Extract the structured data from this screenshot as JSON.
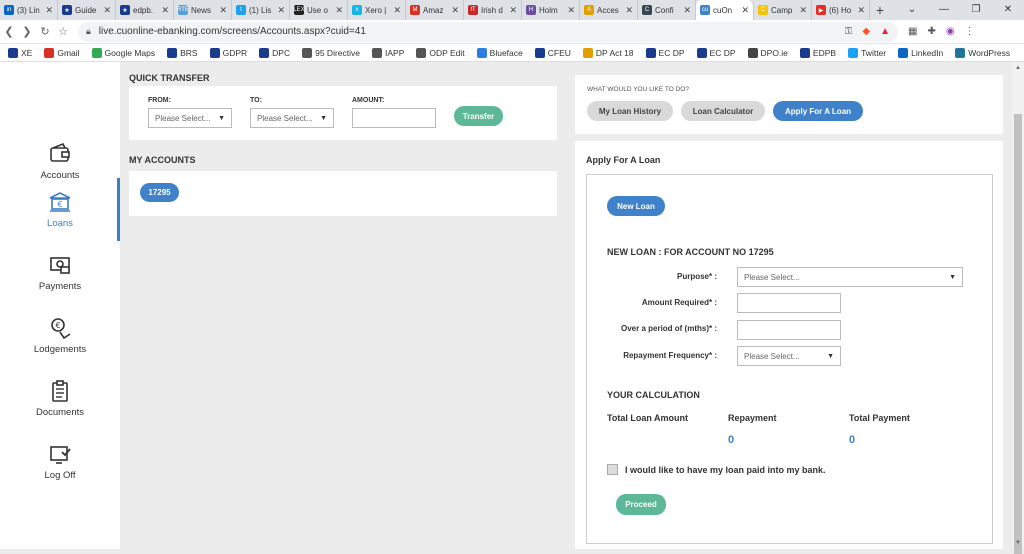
{
  "browser": {
    "tabs": [
      {
        "title": "(3) Lin",
        "favicon": "#0a66c2",
        "glyph": "in"
      },
      {
        "title": "Guide",
        "favicon": "#1a3c8f",
        "glyph": "★"
      },
      {
        "title": "edpb.",
        "favicon": "#1a3c8f",
        "glyph": "★"
      },
      {
        "title": "News",
        "favicon": "#5aa0d8",
        "glyph": "RTÉ"
      },
      {
        "title": "(1) Lis",
        "favicon": "#1da1f2",
        "glyph": "t"
      },
      {
        "title": "Use o",
        "favicon": "#222222",
        "glyph": "LEX"
      },
      {
        "title": "Xero |",
        "favicon": "#13b5ea",
        "glyph": "x"
      },
      {
        "title": "Amaz",
        "favicon": "#d93025",
        "glyph": "M"
      },
      {
        "title": "Irish d",
        "favicon": "#c62828",
        "glyph": "IT"
      },
      {
        "title": "Holm",
        "favicon": "#6a4fa3",
        "glyph": "H"
      },
      {
        "title": "Acces",
        "favicon": "#e0a100",
        "glyph": "A"
      },
      {
        "title": "Confi",
        "favicon": "#37474f",
        "glyph": "C"
      },
      {
        "title": "cuOn",
        "favicon": "#3f82c9",
        "glyph": "cu",
        "active": true
      },
      {
        "title": "Camp",
        "favicon": "#f5c400",
        "glyph": "C"
      },
      {
        "title": "(6) Ho",
        "favicon": "#e52d27",
        "glyph": "▶"
      }
    ],
    "url": "live.cuonline-ebanking.com/screens/Accounts.aspx?cuid=41",
    "bookmarks": [
      {
        "label": "XE",
        "color": "#1a3c8f"
      },
      {
        "label": "Gmail",
        "color": "#d93025"
      },
      {
        "label": "Google Maps",
        "color": "#34a853"
      },
      {
        "label": "BRS",
        "color": "#1a3c8f"
      },
      {
        "label": "GDPR",
        "color": "#1a3c8f"
      },
      {
        "label": "DPC",
        "color": "#1a3c8f"
      },
      {
        "label": "95 Directive",
        "color": "#555555"
      },
      {
        "label": "IAPP",
        "color": "#555555"
      },
      {
        "label": "ODP Edit",
        "color": "#555555"
      },
      {
        "label": "Blueface",
        "color": "#2a7de1"
      },
      {
        "label": "CFEU",
        "color": "#1a3c8f"
      },
      {
        "label": "DP Act 18",
        "color": "#e0a100"
      },
      {
        "label": "EC DP",
        "color": "#1a3c8f"
      },
      {
        "label": "EC DP",
        "color": "#1a3c8f"
      },
      {
        "label": "DPO.ie",
        "color": "#444444"
      },
      {
        "label": "EDPB",
        "color": "#1a3c8f"
      },
      {
        "label": "Twitter",
        "color": "#1da1f2"
      },
      {
        "label": "LinkedIn",
        "color": "#0a66c2"
      },
      {
        "label": "WordPress",
        "color": "#21759b"
      }
    ]
  },
  "sidebar": {
    "items": [
      {
        "label": "Accounts",
        "icon": "wallet-icon"
      },
      {
        "label": "Loans",
        "icon": "bank-icon",
        "active": true
      },
      {
        "label": "Payments",
        "icon": "payments-icon"
      },
      {
        "label": "Lodgements",
        "icon": "lodgement-icon"
      },
      {
        "label": "Documents",
        "icon": "documents-icon"
      },
      {
        "label": "Log Off",
        "icon": "logoff-icon"
      }
    ]
  },
  "quick_transfer": {
    "title": "QUICK TRANSFER",
    "from_label": "FROM:",
    "to_label": "TO:",
    "amount_label": "AMOUNT:",
    "from_placeholder": "Please Select...",
    "to_placeholder": "Please Select...",
    "button": "Transfer"
  },
  "my_accounts": {
    "title": "MY ACCOUNTS",
    "accounts": [
      "17295"
    ]
  },
  "actions": {
    "title": "WHAT WOULD YOU LIKE TO DO?",
    "history": "My Loan History",
    "calculator": "Loan Calculator",
    "apply": "Apply For A Loan"
  },
  "apply_loan": {
    "title": "Apply For A Loan",
    "new_loan_button": "New Loan",
    "heading": "NEW LOAN : FOR ACCOUNT NO 17295",
    "purpose_label": "Purpose* :",
    "purpose_placeholder": "Please Select...",
    "amount_label": "Amount Required* :",
    "period_label": "Over a period of (mths)* :",
    "frequency_label": "Repayment Frequency* :",
    "frequency_placeholder": "Please Select...",
    "calc_title": "YOUR CALCULATION",
    "col_total_loan": "Total Loan Amount",
    "col_repayment": "Repayment",
    "col_total_payment": "Total Payment",
    "repayment_value": "0",
    "total_payment_value": "0",
    "checkbox_label": "I would like to have my loan paid into my bank.",
    "proceed_button": "Proceed"
  }
}
